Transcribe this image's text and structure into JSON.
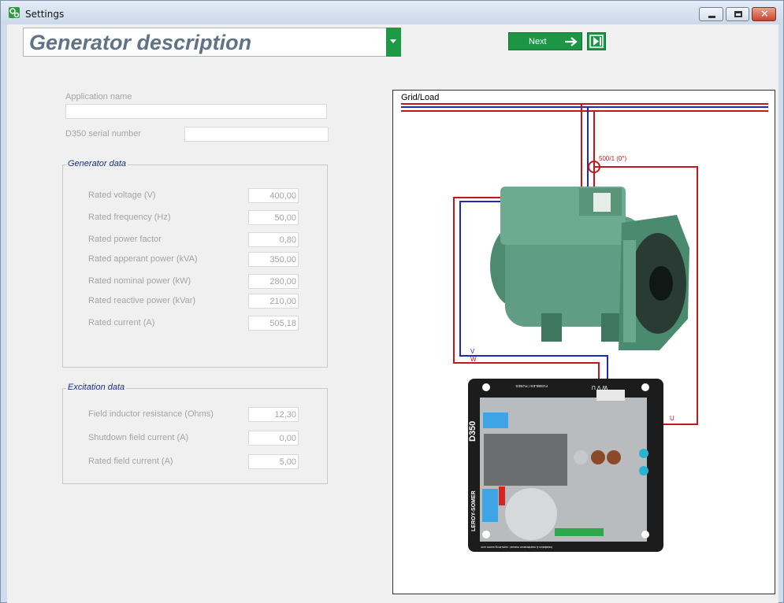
{
  "window": {
    "title": "Settings",
    "app_icon": "gears-icon"
  },
  "header": {
    "page_select": "Generator description",
    "next_label": "Next",
    "accent_color": "#1c9645"
  },
  "form": {
    "application_name": {
      "label": "Application name",
      "value": ""
    },
    "serial_number": {
      "label": "D350 serial number",
      "value": ""
    }
  },
  "generator_data": {
    "title": "Generator data",
    "rows": [
      {
        "label": "Rated voltage (V)",
        "value": "400,00"
      },
      {
        "label": "Rated frequency (Hz)",
        "value": "50,00"
      },
      {
        "label": "Rated power factor",
        "value": "0,80"
      },
      {
        "label": "Rated apperant power (kVA)",
        "value": "350,00"
      },
      {
        "label": "Rated nominal power (kW)",
        "value": "280,00"
      },
      {
        "label": "Rated reactive power (kVar)",
        "value": "210,00"
      },
      {
        "label": "Rated current (A)",
        "value": "505,18"
      }
    ]
  },
  "excitation_data": {
    "title": "Excitation data",
    "rows": [
      {
        "label": "Field inductor resistance (Ohms)",
        "value": "12,30"
      },
      {
        "label": "Shutdown field current (A)",
        "value": "0,00"
      },
      {
        "label": "Rated field current (A)",
        "value": "5,00"
      }
    ]
  },
  "diagram": {
    "grid_label": "Grid/Load",
    "ct_label": "500/1 (0°)",
    "wire_v": "V",
    "wire_w": "W",
    "wire_u": "U",
    "board_model": "D350",
    "board_brand": "LEROY-SOMER",
    "board_fuses": "FUSIBLES / FUSES",
    "board_terminals": "W V U",
    "board_manual": "Installation & maintenance manual : www.leroy-somer.com"
  }
}
